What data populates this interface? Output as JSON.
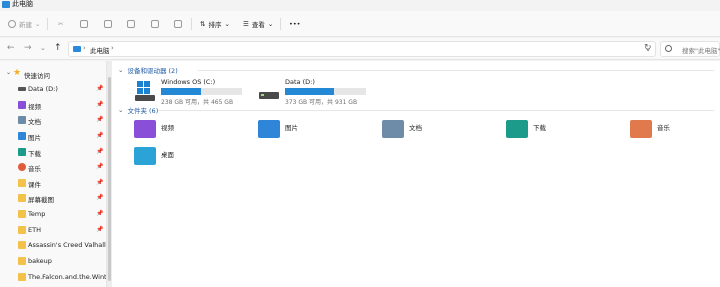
{
  "window": {
    "title": "此电脑"
  },
  "toolbar": {
    "new_label": "新建",
    "sort_label": "排序",
    "view_label": "查看",
    "more_label": "•••"
  },
  "address": {
    "location": "此电脑",
    "search_placeholder": "搜索\"此电脑\""
  },
  "sidebar": {
    "quick_access": "快速访问",
    "items": [
      {
        "label": "Data (D:)",
        "icon": "drive-icon",
        "pinned": true
      },
      {
        "label": "视频",
        "icon": "videos-icon",
        "pinned": true
      },
      {
        "label": "文档",
        "icon": "documents-icon",
        "pinned": true
      },
      {
        "label": "图片",
        "icon": "pictures-icon",
        "pinned": true
      },
      {
        "label": "下载",
        "icon": "downloads-icon",
        "pinned": true
      },
      {
        "label": "音乐",
        "icon": "music-icon",
        "pinned": true
      },
      {
        "label": "课件",
        "icon": "folder-icon",
        "pinned": true
      },
      {
        "label": "屏幕截图",
        "icon": "folder-icon",
        "pinned": true
      },
      {
        "label": "Temp",
        "icon": "folder-icon",
        "pinned": true
      },
      {
        "label": "ETH",
        "icon": "folder-icon",
        "pinned": true
      },
      {
        "label": "Assassin's Creed Valhalla",
        "icon": "folder-icon",
        "pinned": false
      },
      {
        "label": "bakeup",
        "icon": "folder-icon",
        "pinned": false
      },
      {
        "label": "The.Falcon.and.the.Winter.S",
        "icon": "folder-icon",
        "pinned": false
      }
    ]
  },
  "main": {
    "devices_header": "设备和驱动器 (2)",
    "folders_header": "文件夹 (6)",
    "drives": [
      {
        "name": "Windows OS (C:)",
        "info": "238 GB 可用，共 465 GB",
        "used_fraction": 0.49
      },
      {
        "name": "Data (D:)",
        "info": "373 GB 可用，共 931 GB",
        "used_fraction": 0.6
      }
    ],
    "folders": [
      {
        "name": "视频",
        "color": "#8a4fd8"
      },
      {
        "name": "图片",
        "color": "#2f86d8"
      },
      {
        "name": "文档",
        "color": "#6e8ca8"
      },
      {
        "name": "下载",
        "color": "#1c9b8a"
      },
      {
        "name": "音乐",
        "color": "#e07a4c"
      },
      {
        "name": "桌面",
        "color": "#2ba3d6"
      }
    ]
  }
}
